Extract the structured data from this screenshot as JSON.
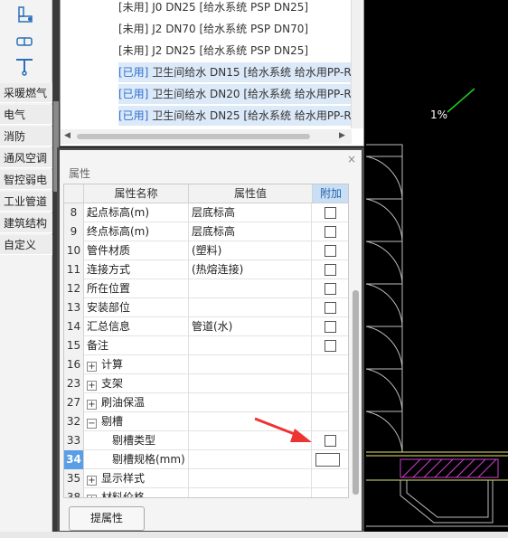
{
  "sidebar": {
    "tool_icons": [
      "valve-icon",
      "pipe-fitting-icon",
      "tee-icon"
    ],
    "categories": [
      "采暖燃气",
      "电气",
      "消防",
      "通风空调",
      "智控弱电",
      "工业管道",
      "建筑结构",
      "自定义"
    ]
  },
  "pipe_list": {
    "items": [
      {
        "tag": "[未用]",
        "text": "J0 DN25 [给水系统 PSP DN25]",
        "used": false
      },
      {
        "tag": "[未用]",
        "text": "J2 DN70 [给水系统 PSP DN70]",
        "used": false
      },
      {
        "tag": "[未用]",
        "text": "J2 DN25 [给水系统 PSP DN25]",
        "used": false
      },
      {
        "tag": "[已用]",
        "text": "卫生间给水 DN15 [给水系统 给水用PP-R",
        "used": true
      },
      {
        "tag": "[已用]",
        "text": "卫生间给水 DN20 [给水系统 给水用PP-R",
        "used": true
      },
      {
        "tag": "[已用]",
        "text": "卫生间给水 DN25 [给水系统 给水用PP-R",
        "used": true
      }
    ]
  },
  "properties": {
    "title": "属性",
    "close": "×",
    "headers": {
      "name": "属性名称",
      "value": "属性值",
      "add": "附加"
    },
    "rows": [
      {
        "num": "8",
        "name": "起点标高(m)",
        "value": "层底标高",
        "expander": "",
        "indent": false,
        "checkbox": true
      },
      {
        "num": "9",
        "name": "终点标高(m)",
        "value": "层底标高",
        "expander": "",
        "indent": false,
        "checkbox": true
      },
      {
        "num": "10",
        "name": "管件材质",
        "value": "(塑料)",
        "expander": "",
        "indent": false,
        "checkbox": true
      },
      {
        "num": "11",
        "name": "连接方式",
        "value": "(热熔连接)",
        "expander": "",
        "indent": false,
        "checkbox": true
      },
      {
        "num": "12",
        "name": "所在位置",
        "value": "",
        "expander": "",
        "indent": false,
        "checkbox": true
      },
      {
        "num": "13",
        "name": "安装部位",
        "value": "",
        "expander": "",
        "indent": false,
        "checkbox": true
      },
      {
        "num": "14",
        "name": "汇总信息",
        "value": "管道(水)",
        "expander": "",
        "indent": false,
        "checkbox": true
      },
      {
        "num": "15",
        "name": "备注",
        "value": "",
        "expander": "",
        "indent": false,
        "checkbox": true
      },
      {
        "num": "16",
        "name": "计算",
        "value": "",
        "expander": "+",
        "indent": false,
        "checkbox": false
      },
      {
        "num": "23",
        "name": "支架",
        "value": "",
        "expander": "+",
        "indent": false,
        "checkbox": false
      },
      {
        "num": "27",
        "name": "刷油保温",
        "value": "",
        "expander": "+",
        "indent": false,
        "checkbox": false
      },
      {
        "num": "32",
        "name": "剔槽",
        "value": "",
        "expander": "−",
        "indent": false,
        "checkbox": false
      },
      {
        "num": "33",
        "name": "剔槽类型",
        "value": "",
        "expander": "",
        "indent": true,
        "checkbox": true
      },
      {
        "num": "34",
        "name": "剔槽规格(mm)",
        "value": "",
        "expander": "",
        "indent": true,
        "checkbox": true,
        "selected": true
      },
      {
        "num": "35",
        "name": "显示样式",
        "value": "",
        "expander": "+",
        "indent": false,
        "checkbox": false
      },
      {
        "num": "38",
        "name": "材料价格",
        "value": "",
        "expander": "+",
        "indent": false,
        "checkbox": false
      }
    ],
    "extract_button": "提属性"
  },
  "cad": {
    "label": "1%"
  },
  "colors": {
    "accent": "#5b9ee6",
    "used_tag": "#2f6fd0",
    "arrow": "#ee3333",
    "magenta": "#d040d0"
  }
}
